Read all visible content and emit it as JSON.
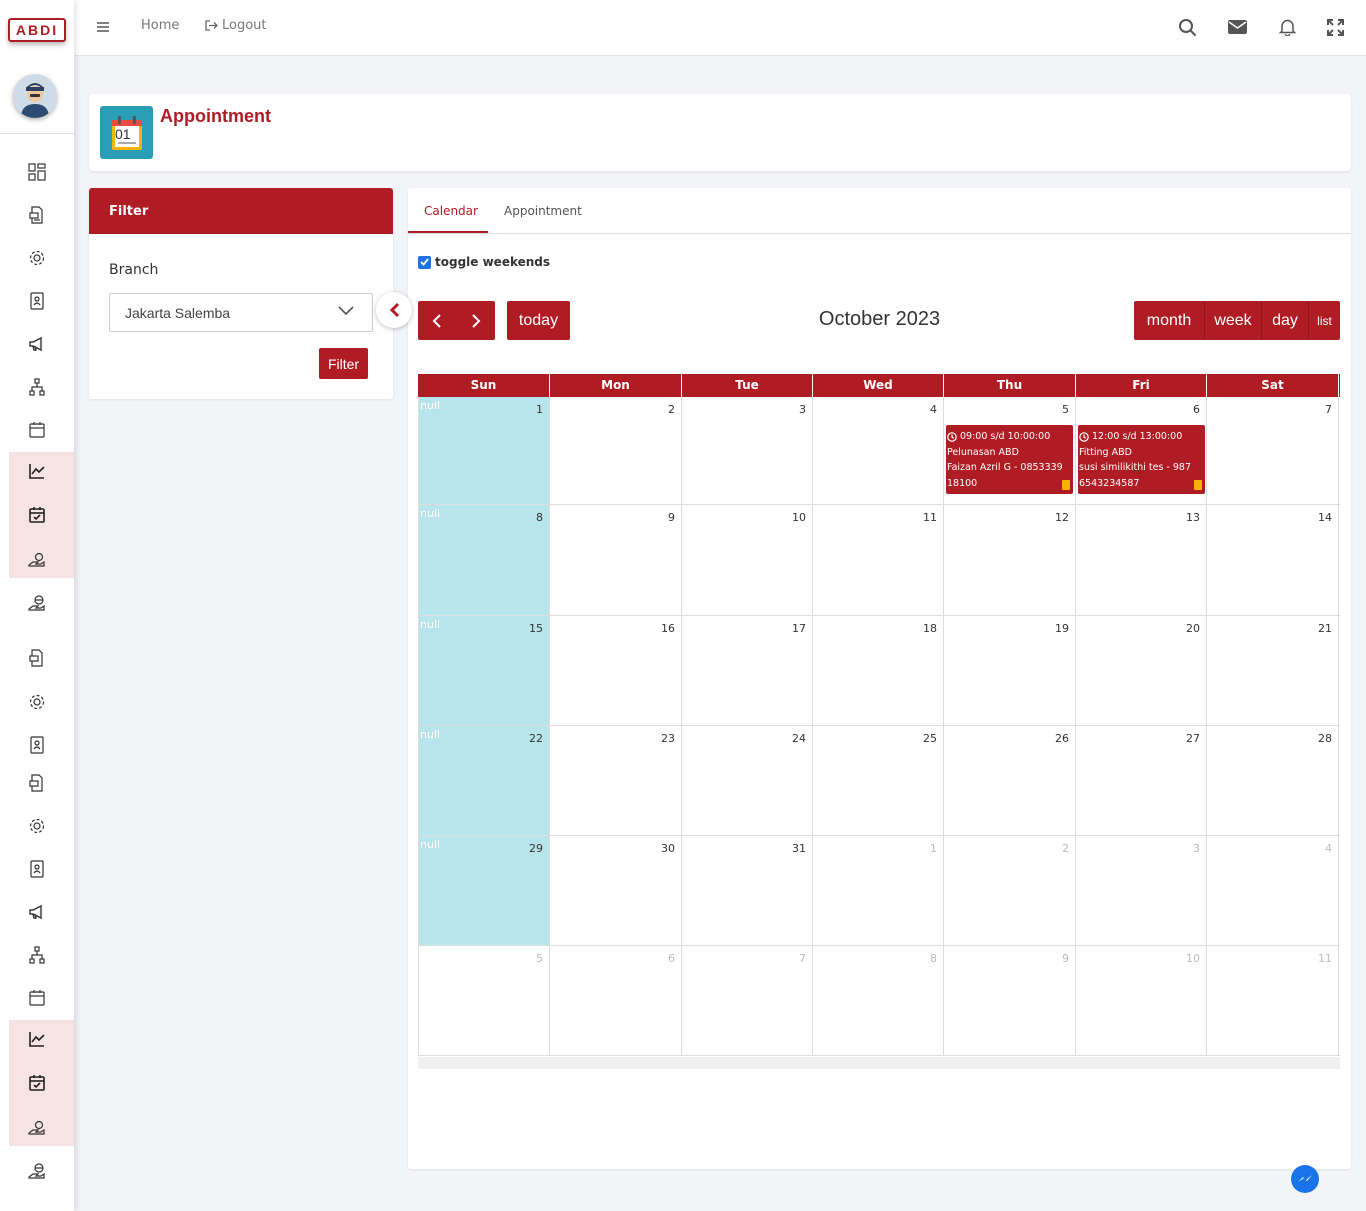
{
  "app": {
    "logo_text": "ABDI"
  },
  "topbar": {
    "home": "Home",
    "logout": "Logout"
  },
  "header": {
    "title": "Appointment",
    "icon_number": "01"
  },
  "filter": {
    "title": "Filter",
    "branch_label": "Branch",
    "branch_value": "Jakarta Salemba",
    "button": "Filter"
  },
  "tabs": {
    "calendar": "Calendar",
    "appointment": "Appointment"
  },
  "calendar": {
    "toggle_weekends": "toggle weekends",
    "title": "October 2023",
    "today": "today",
    "views": {
      "month": "month",
      "week": "week",
      "day": "day",
      "list": "list"
    },
    "weekdays": [
      "Sun",
      "Mon",
      "Tue",
      "Wed",
      "Thu",
      "Fri",
      "Sat"
    ],
    "null_label": "null",
    "weeks": [
      [
        "1",
        "2",
        "3",
        "4",
        "5",
        "6",
        "7"
      ],
      [
        "8",
        "9",
        "10",
        "11",
        "12",
        "13",
        "14"
      ],
      [
        "15",
        "16",
        "17",
        "18",
        "19",
        "20",
        "21"
      ],
      [
        "22",
        "23",
        "24",
        "25",
        "26",
        "27",
        "28"
      ],
      [
        "29",
        "30",
        "31",
        "1",
        "2",
        "3",
        "4"
      ],
      [
        "5",
        "6",
        "7",
        "8",
        "9",
        "10",
        "11"
      ]
    ],
    "events": [
      {
        "time": "09:00 s/d 10:00:00",
        "title": "Pelunasan ABD",
        "detail": "Faizan Azril G - 085333918100"
      },
      {
        "time": "12:00 s/d 13:00:00",
        "title": "Fitting ABD",
        "detail": "susi similikithi tes - 9876543234587"
      }
    ]
  },
  "colors": {
    "brand": "#b01c24",
    "sunday": "#b8e4ec",
    "band": "#f6e3e4"
  }
}
